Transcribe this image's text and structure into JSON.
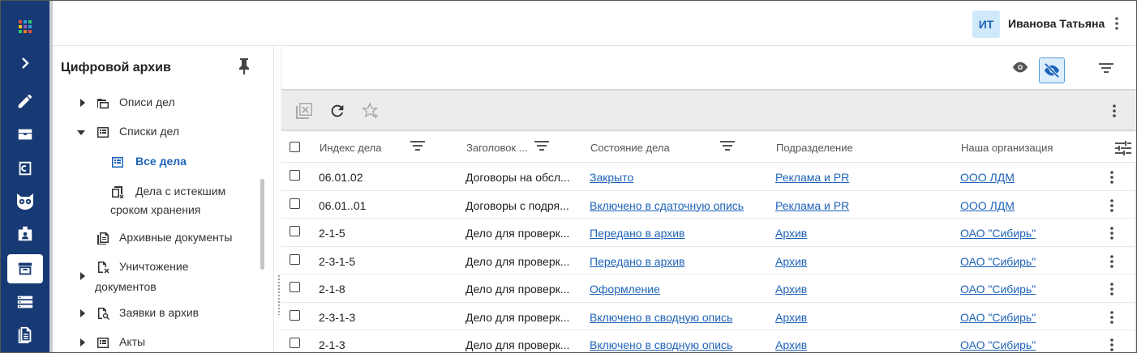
{
  "colors": {
    "rail_bg": "#173a74",
    "accent": "#1e63b8",
    "avatar_bg": "#cfe9fb",
    "toolbar_bg": "#ececec"
  },
  "rail": {
    "items": [
      {
        "icon": "apps-grid-icon"
      },
      {
        "icon": "chevron-right-icon"
      },
      {
        "icon": "pencil-icon"
      },
      {
        "icon": "inbox-tray-icon"
      },
      {
        "icon": "letter-c-icon"
      },
      {
        "icon": "owl-icon"
      },
      {
        "icon": "badge-id-icon"
      },
      {
        "icon": "archive-box-icon",
        "active": true
      },
      {
        "icon": "storage-stack-icon"
      },
      {
        "icon": "document-list-icon"
      }
    ]
  },
  "header": {
    "avatar_initials": "ИТ",
    "user_name": "Иванова Татьяна"
  },
  "tree": {
    "title": "Цифровой архив",
    "items": [
      {
        "label": "Описи дел",
        "icon": "folder-stack-icon",
        "expander": "collapsed"
      },
      {
        "label": "Списки дел",
        "icon": "list-box-icon",
        "expander": "expanded"
      },
      {
        "label": "Все дела",
        "icon": "list-box-icon",
        "selected": true
      },
      {
        "label": "Дела с истекшим",
        "label2": "сроком хранения",
        "icon": "expired-files-icon"
      },
      {
        "label": "Архивные документы",
        "icon": "document-copy-icon"
      },
      {
        "label": "Уничтожение",
        "label2": "документов",
        "icon": "document-delete-icon",
        "expander": "collapsed"
      },
      {
        "label": "Заявки в архив",
        "icon": "document-search-icon",
        "expander": "collapsed"
      },
      {
        "label": "Акты",
        "icon": "list-box-icon",
        "expander": "collapsed"
      }
    ]
  },
  "grid": {
    "columns": [
      {
        "label": "Индекс дела",
        "filter": true
      },
      {
        "label": "Заголовок ...",
        "filter": true
      },
      {
        "label": "Состояние дела",
        "filter": true
      },
      {
        "label": "Подразделение",
        "filter": false
      },
      {
        "label": "Наша организация",
        "filter": false
      }
    ],
    "rows": [
      {
        "index": "06.01.02",
        "title": "Договоры на обсл...",
        "state": "Закрыто",
        "dept": "Реклама и PR",
        "org": "ООО ЛДМ"
      },
      {
        "index": "06.01..01",
        "title": "Договоры с подря...",
        "state": "Включено в сдаточную опись",
        "dept": "Реклама и PR",
        "org": "ООО ЛДМ"
      },
      {
        "index": "2-1-5",
        "title": "Дело для проверк...",
        "state": "Передано в архив",
        "dept": "Архив",
        "org": "ОАО \"Сибирь\""
      },
      {
        "index": "2-3-1-5",
        "title": "Дело для проверк...",
        "state": "Передано в архив",
        "dept": "Архив",
        "org": "ОАО \"Сибирь\""
      },
      {
        "index": "2-1-8",
        "title": "Дело для проверк...",
        "state": "Оформление",
        "dept": "Архив",
        "org": "ОАО \"Сибирь\""
      },
      {
        "index": "2-3-1-3",
        "title": "Дело для проверк...",
        "state": "Включено в сводную опись",
        "dept": "Архив",
        "org": "ОАО \"Сибирь\""
      },
      {
        "index": "2-1-3",
        "title": "Дело для проверк...",
        "state": "Включено в сводную опись",
        "dept": "Архив",
        "org": "ОАО \"Сибирь\""
      }
    ]
  }
}
